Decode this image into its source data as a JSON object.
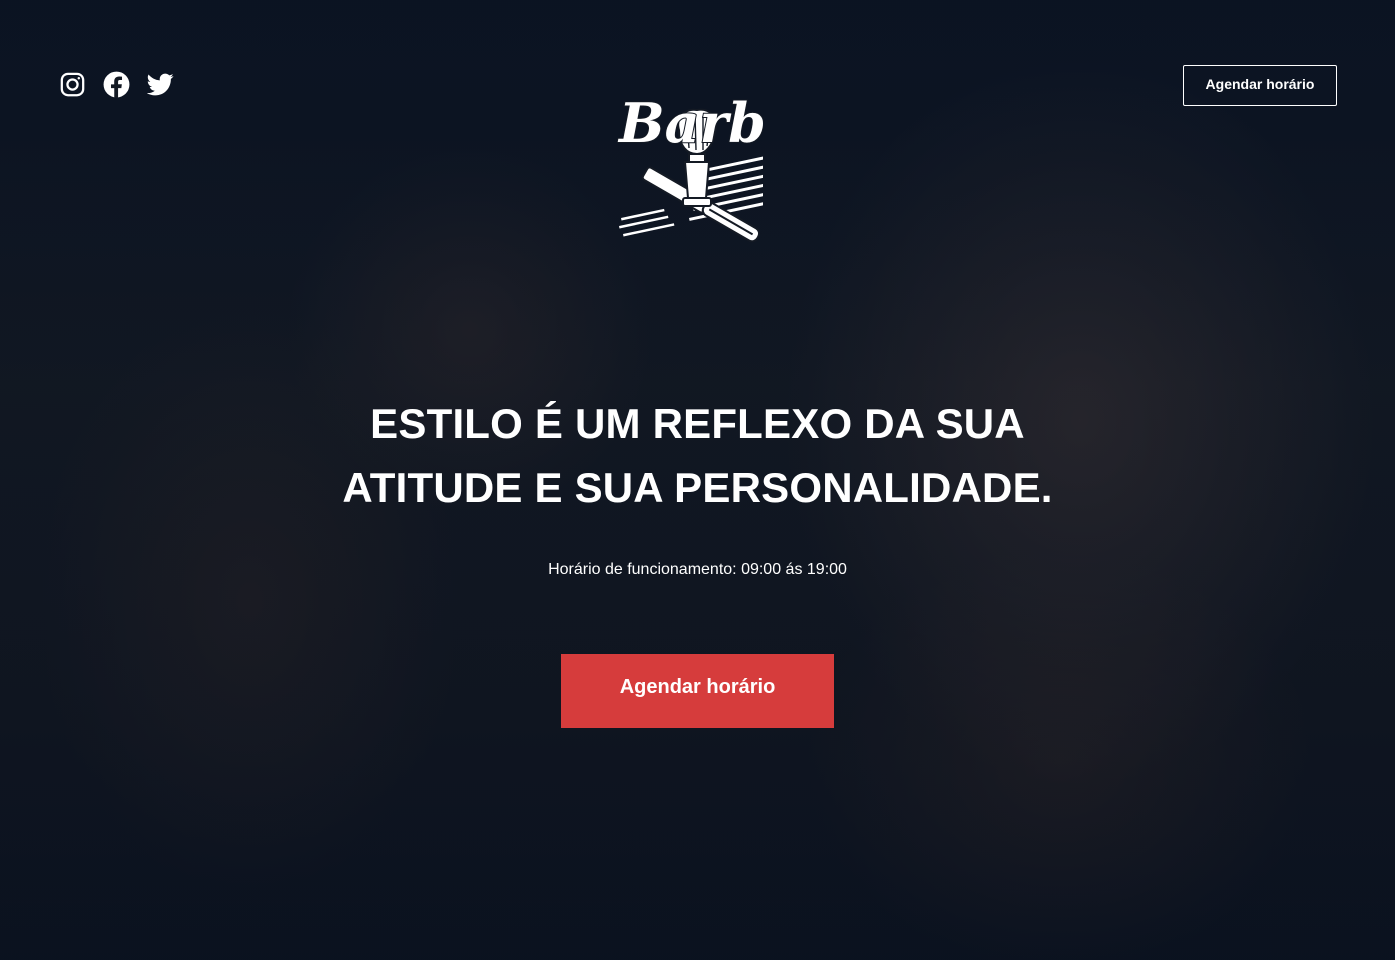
{
  "header": {
    "socials": [
      {
        "icon": "instagram-icon"
      },
      {
        "icon": "facebook-icon"
      },
      {
        "icon": "twitter-icon"
      }
    ],
    "logo": {
      "text": "Barber"
    },
    "schedule_button_label": "Agendar horário"
  },
  "hero": {
    "headline_line1": "ESTILO É UM REFLEXO DA SUA",
    "headline_line2": "ATITUDE E SUA PERSONALIDADE.",
    "hours_text": "Horário de funcionamento: 09:00 ás 19:00",
    "cta_label": "Agendar horário"
  },
  "colors": {
    "accent": "#d63c3c",
    "text": "#ffffff",
    "overlay": "#0b1220"
  }
}
